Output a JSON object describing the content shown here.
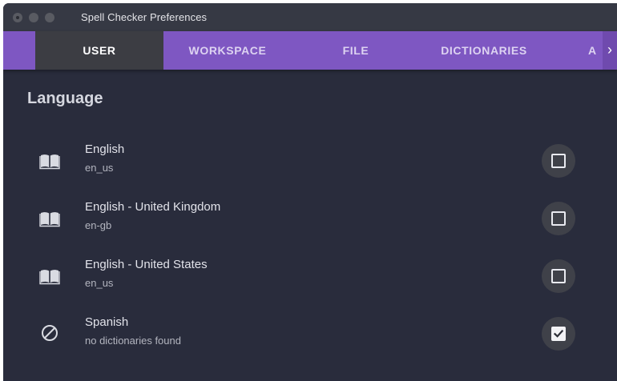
{
  "window": {
    "title": "Spell Checker Preferences"
  },
  "tabs": [
    {
      "label": "USER",
      "active": true
    },
    {
      "label": "WORKSPACE",
      "active": false
    },
    {
      "label": "FILE",
      "active": false
    },
    {
      "label": "DICTIONARIES",
      "active": false
    },
    {
      "label": "A",
      "active": false
    }
  ],
  "tab_scroll_glyph": "›",
  "section": {
    "title": "Language"
  },
  "languages": [
    {
      "name": "English",
      "code": "en_us",
      "icon": "book-icon",
      "checked": false
    },
    {
      "name": "English - United Kingdom",
      "code": "en-gb",
      "icon": "book-icon",
      "checked": false
    },
    {
      "name": "English - United States",
      "code": "en_us",
      "icon": "book-icon",
      "checked": false
    },
    {
      "name": "Spanish",
      "code": "no dictionaries found",
      "icon": "block-icon",
      "checked": true
    }
  ],
  "colors": {
    "window_bg": "#292c3c",
    "tab_accent": "#7e57c2",
    "active_tab_bg": "#3c3d43"
  }
}
